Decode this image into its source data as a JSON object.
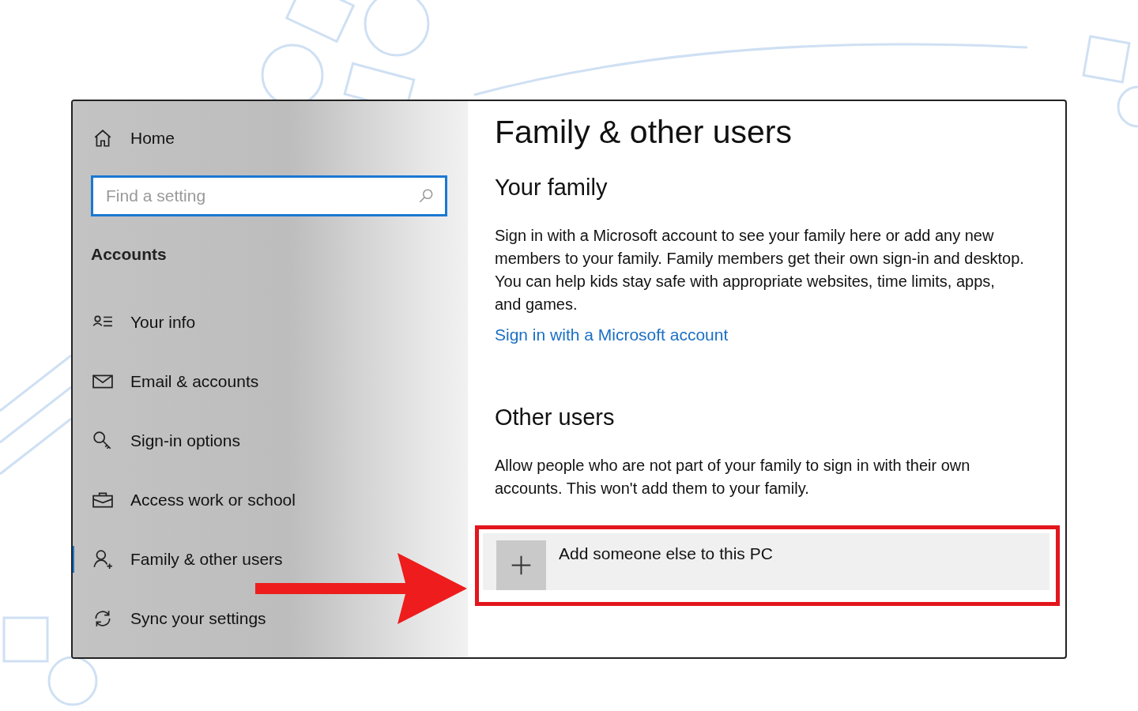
{
  "sidebar": {
    "home": "Home",
    "search": {
      "placeholder": "Find a setting"
    },
    "section": "Accounts",
    "items": [
      {
        "label": "Your info",
        "selected": false
      },
      {
        "label": "Email & accounts",
        "selected": false
      },
      {
        "label": "Sign-in options",
        "selected": false
      },
      {
        "label": "Access work or school",
        "selected": false
      },
      {
        "label": "Family & other users",
        "selected": true
      },
      {
        "label": "Sync your settings",
        "selected": false
      }
    ]
  },
  "main": {
    "title": "Family & other users",
    "family": {
      "heading": "Your family",
      "text": "Sign in with a Microsoft account to see your family here or add any new members to your family. Family members get their own sign-in and desktop. You can help kids stay safe with appropriate websites, time limits, apps, and games.",
      "link": "Sign in with a Microsoft account"
    },
    "other": {
      "heading": "Other users",
      "text": "Allow people who are not part of your family to sign in with their own accounts. This won't add them to your family.",
      "add_button": "Add someone else to this PC"
    }
  }
}
